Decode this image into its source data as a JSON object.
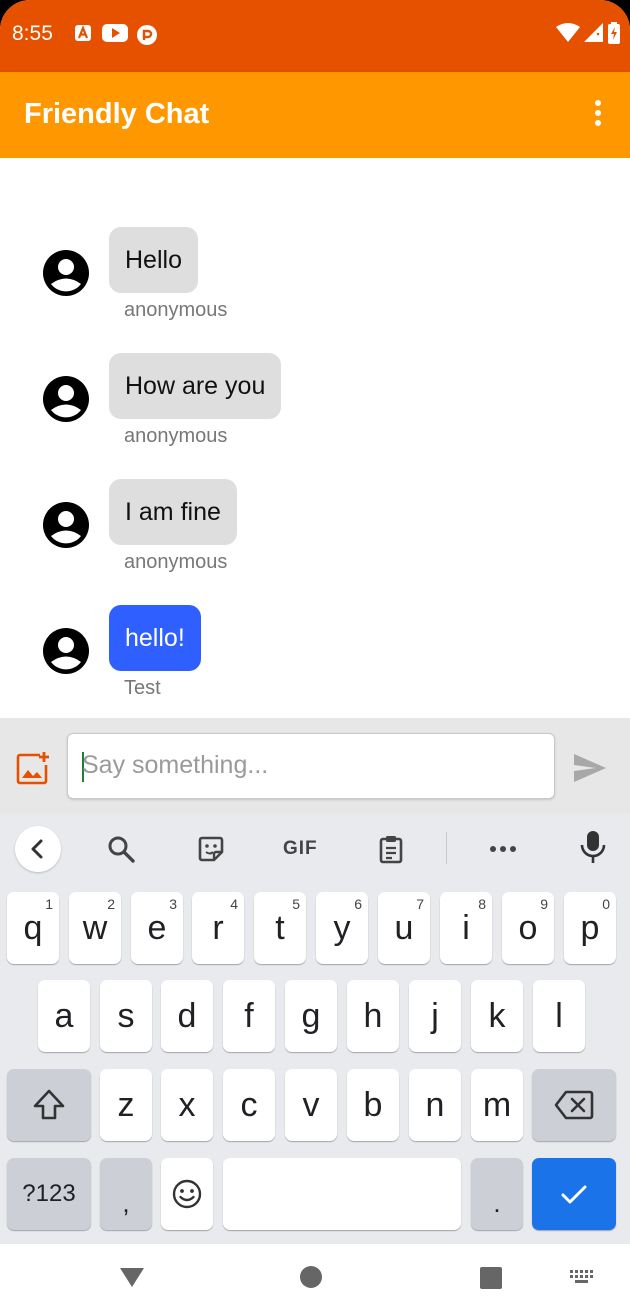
{
  "status_bar": {
    "time": "8:55",
    "icons": [
      "a-icon",
      "youtube-icon",
      "app-icon",
      "wifi-icon",
      "signal-icon",
      "battery-icon"
    ]
  },
  "app_bar": {
    "title": "Friendly Chat",
    "menu_icon": "more-vert-icon"
  },
  "messages": [
    {
      "text": "Hello",
      "sender": "anonymous",
      "mine": false
    },
    {
      "text": "How are you",
      "sender": "anonymous",
      "mine": false
    },
    {
      "text": "I am fine",
      "sender": "anonymous",
      "mine": false
    },
    {
      "text": "hello!",
      "sender": "Test",
      "mine": true
    }
  ],
  "input": {
    "placeholder": "Say something...",
    "value": ""
  },
  "keyboard": {
    "toolbar": [
      "back-icon",
      "search-icon",
      "sticker-icon",
      "GIF",
      "clipboard-icon",
      "more-icon",
      "mic-icon"
    ],
    "row1": [
      "q",
      "w",
      "e",
      "r",
      "t",
      "y",
      "u",
      "i",
      "o",
      "p"
    ],
    "row1_hints": [
      "1",
      "2",
      "3",
      "4",
      "5",
      "6",
      "7",
      "8",
      "9",
      "0"
    ],
    "row2": [
      "a",
      "s",
      "d",
      "f",
      "g",
      "h",
      "j",
      "k",
      "l"
    ],
    "row3": [
      "z",
      "x",
      "c",
      "v",
      "b",
      "n",
      "m"
    ],
    "sym_key": "?123",
    "comma": ",",
    "period": "."
  },
  "colors": {
    "status_bar": "#E65100",
    "app_bar": "#FF9800",
    "bubble_other": "#DEDEDE",
    "bubble_mine": "#2F60FF",
    "keyboard_action": "#1A73E8"
  }
}
